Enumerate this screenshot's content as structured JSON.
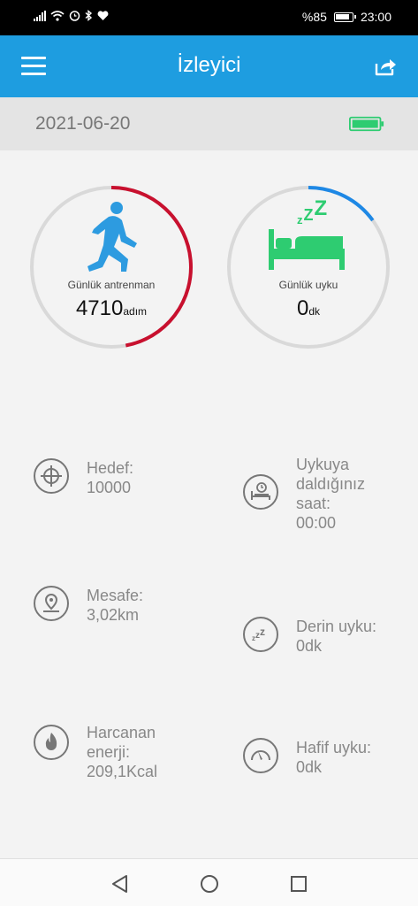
{
  "status_bar": {
    "battery_percent": "%85",
    "time": "23:00",
    "icons": [
      "signal-icon",
      "wifi-icon",
      "alarm-icon",
      "bluetooth-icon",
      "heart-icon"
    ]
  },
  "app_bar": {
    "title": "İzleyici",
    "menu_icon": "hamburger-menu-icon",
    "share_icon": "share-icon"
  },
  "date_bar": {
    "date": "2021-06-20",
    "device_battery_icon": "battery-icon",
    "device_battery_color": "#2ecc71"
  },
  "activity_ring": {
    "label": "Günlük antrenman",
    "value": "4710",
    "unit": "adım",
    "progress": 0.471,
    "color": "#c8102e",
    "icon": "runner-icon"
  },
  "sleep_ring": {
    "label": "Günlük uyku",
    "value": "0",
    "unit": "dk",
    "progress": 0.15,
    "color": "#1e88e5",
    "icon": "sleep-bed-icon",
    "zzz": "zZZ"
  },
  "stats_left": [
    {
      "icon": "target-icon",
      "lines": [
        "Hedef:",
        "10000"
      ]
    },
    {
      "icon": "map-pin-icon",
      "lines": [
        "Mesafe:",
        "3,02km"
      ]
    },
    {
      "icon": "flame-icon",
      "lines": [
        "Harcanan",
        "enerji:",
        "209,1Kcal"
      ]
    }
  ],
  "stats_right": [
    {
      "icon": "bed-clock-icon",
      "lines": [
        "Uykuya",
        "daldığınız",
        "saat:",
        "00:00"
      ]
    },
    {
      "icon": "zzz-icon",
      "lines": [
        "Derin uyku:",
        "0dk"
      ]
    },
    {
      "icon": "gauge-icon",
      "lines": [
        "Hafif uyku:",
        "0dk"
      ]
    }
  ],
  "nav_bar": {
    "buttons": [
      "back-icon",
      "home-icon",
      "recents-icon"
    ]
  }
}
